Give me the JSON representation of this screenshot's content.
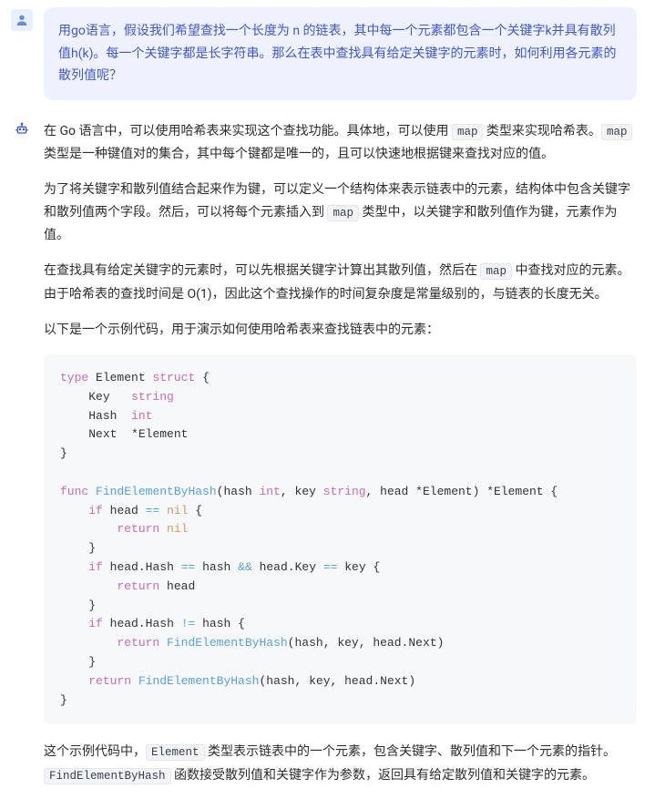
{
  "user_message": {
    "text": "用go语言，假设我们希望查找一个长度为 n 的链表，其中每一个元素都包含一个关键字k并具有散列值h(k)。每一个关键字都是长字符串。那么在表中查找具有给定关键字的元素时，如何利用各元素的散列值呢？"
  },
  "assistant_message": {
    "p1_pre": "在 Go 语言中，可以使用哈希表来实现这个查找功能。具体地，可以使用 ",
    "p1_code1": "map",
    "p1_mid": " 类型来实现哈希表。",
    "p1_code2": "map",
    "p1_post": " 类型是一种键值对的集合，其中每个键都是唯一的，且可以快速地根据键来查找对应的值。",
    "p2_pre": "为了将关键字和散列值结合起来作为键，可以定义一个结构体来表示链表中的元素，结构体中包含关键字和散列值两个字段。然后，可以将每个元素插入到 ",
    "p2_code": "map",
    "p2_post": " 类型中，以关键字和散列值作为键，元素作为值。",
    "p3_pre": "在查找具有给定关键字的元素时，可以先根据关键字计算出其散列值，然后在 ",
    "p3_code": "map",
    "p3_post": " 中查找对应的元素。由于哈希表的查找时间是 O(1)，因此这个查找操作的时间复杂度是常量级别的，与链表的长度无关。",
    "p4": "以下是一个示例代码，用于演示如何使用哈希表来查找链表中的元素：",
    "p5_pre": "这个示例代码中，",
    "p5_code1": "Element",
    "p5_mid": " 类型表示链表中的一个元素，包含关键字、散列值和下一个元素的指针。",
    "p5_code2": "FindElementByHash",
    "p5_post": " 函数接受散列值和关键字作为参数，返回具有给定散列值和关键字的元素。"
  },
  "code": {
    "kw_type": "type",
    "kw_struct": "struct",
    "kw_func": "func",
    "kw_if": "if",
    "kw_return": "return",
    "kw_nil": "nil",
    "id_Element": "Element",
    "id_Key": "Key",
    "id_Hash": "Hash",
    "id_Next": "Next",
    "ty_string": "string",
    "ty_int": "int",
    "fn_FindElementByHash": "FindElementByHash",
    "p_hash": "hash",
    "p_key": "key",
    "p_head": "head",
    "op_eq": "==",
    "op_neq": "!=",
    "op_and": "&&"
  }
}
